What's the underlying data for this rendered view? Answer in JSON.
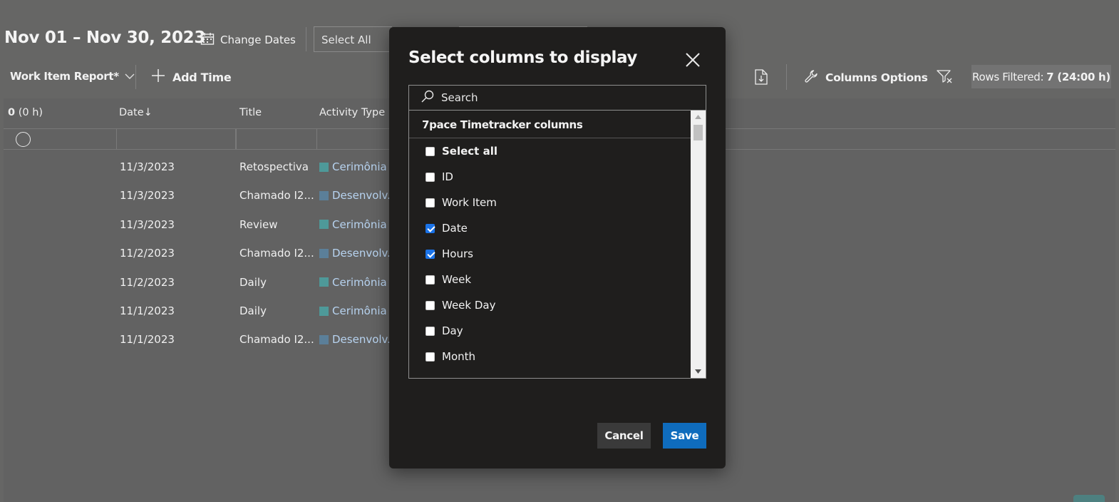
{
  "header": {
    "date_range": "Nov 01 – Nov 30, 2023",
    "change_dates": "Change Dates",
    "select_all": "Select All"
  },
  "toolbar": {
    "report": "Work Item Report*",
    "add_time": "Add Time",
    "columns_options": "Columns Options",
    "rows_filtered_label": "Rows Filtered:",
    "rows_filtered_value": "7 (24:00 h)"
  },
  "grid": {
    "summary_count": "0",
    "summary_hours": "(0 h)",
    "columns": {
      "date": "Date↓",
      "title": "Title",
      "activity": "Activity Type"
    },
    "rows": [
      {
        "date": "11/3/2023",
        "title": "Retospectiva",
        "activity": "Cerimônia",
        "color": "#4e9999"
      },
      {
        "date": "11/3/2023",
        "title": "Chamado I2...",
        "activity": "Desenvolv...",
        "color": "#5b7f99"
      },
      {
        "date": "11/3/2023",
        "title": "Review",
        "activity": "Cerimônia",
        "color": "#4e9999"
      },
      {
        "date": "11/2/2023",
        "title": "Chamado I2...",
        "activity": "Desenvolv...",
        "color": "#5b7f99"
      },
      {
        "date": "11/2/2023",
        "title": "Daily",
        "activity": "Cerimônia",
        "color": "#4e9999"
      },
      {
        "date": "11/1/2023",
        "title": "Daily",
        "activity": "Cerimônia",
        "color": "#4e9999"
      },
      {
        "date": "11/1/2023",
        "title": "Chamado I2...",
        "activity": "Desenvolv...",
        "color": "#5b7f99"
      }
    ]
  },
  "modal": {
    "title": "Select columns to display",
    "search_placeholder": "Search",
    "group": "7pace Timetracker columns",
    "items": [
      {
        "label": "Select all",
        "checked": false,
        "bold": true
      },
      {
        "label": "ID",
        "checked": false
      },
      {
        "label": "Work Item",
        "checked": false
      },
      {
        "label": "Date",
        "checked": true
      },
      {
        "label": "Hours",
        "checked": true
      },
      {
        "label": "Week",
        "checked": false
      },
      {
        "label": "Week Day",
        "checked": false
      },
      {
        "label": "Day",
        "checked": false
      },
      {
        "label": "Month",
        "checked": false
      }
    ],
    "cancel": "Cancel",
    "save": "Save"
  },
  "colors": {
    "accent": "#0f6cbd",
    "checkbox_checked": "#1a73e8",
    "modal_bg": "#1f1e1d",
    "overlay_bg": "#666665"
  }
}
